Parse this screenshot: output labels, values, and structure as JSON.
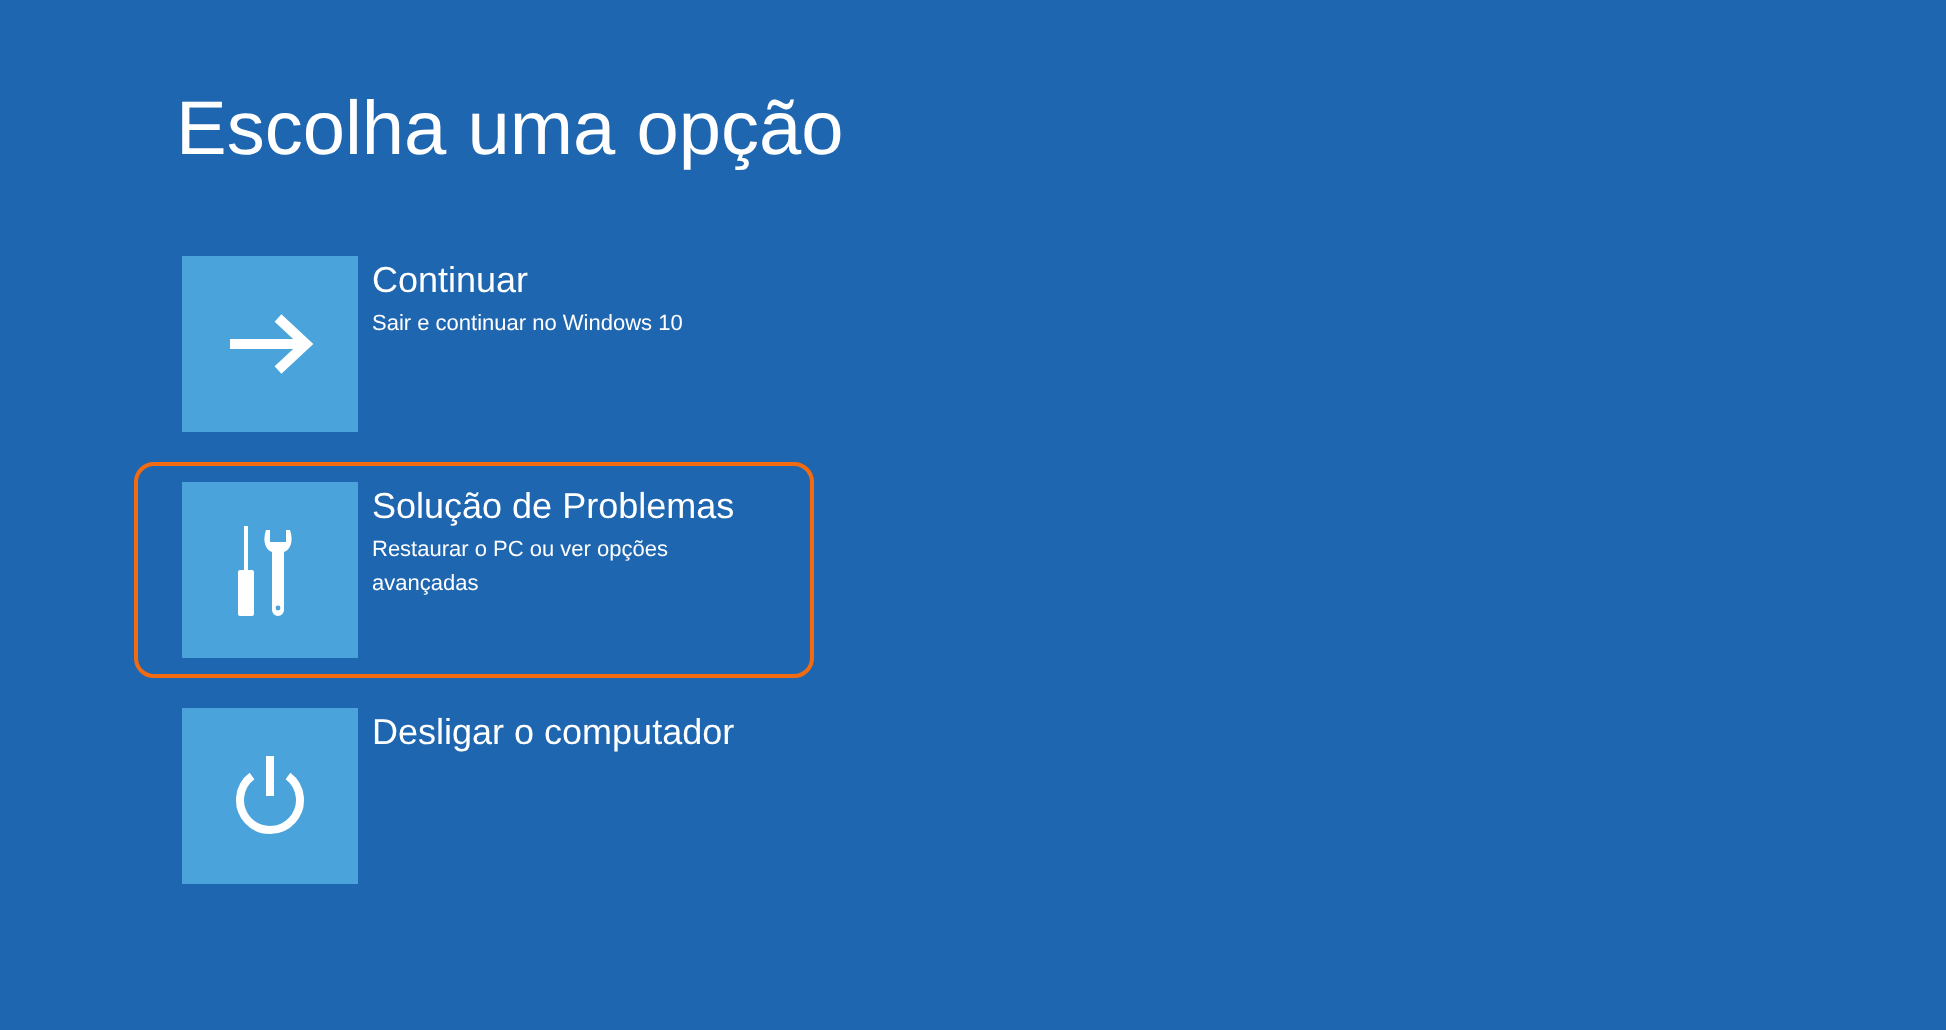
{
  "title": "Escolha uma opção",
  "options": [
    {
      "kind": "continue",
      "label": "Continuar",
      "description": "Sair e continuar no Windows 10",
      "highlighted": false
    },
    {
      "kind": "troubleshoot",
      "label": "Solução de Problemas",
      "description": "Restaurar o PC ou ver opções avançadas",
      "highlighted": true
    },
    {
      "kind": "power",
      "label": "Desligar o computador",
      "highlighted": false
    }
  ]
}
